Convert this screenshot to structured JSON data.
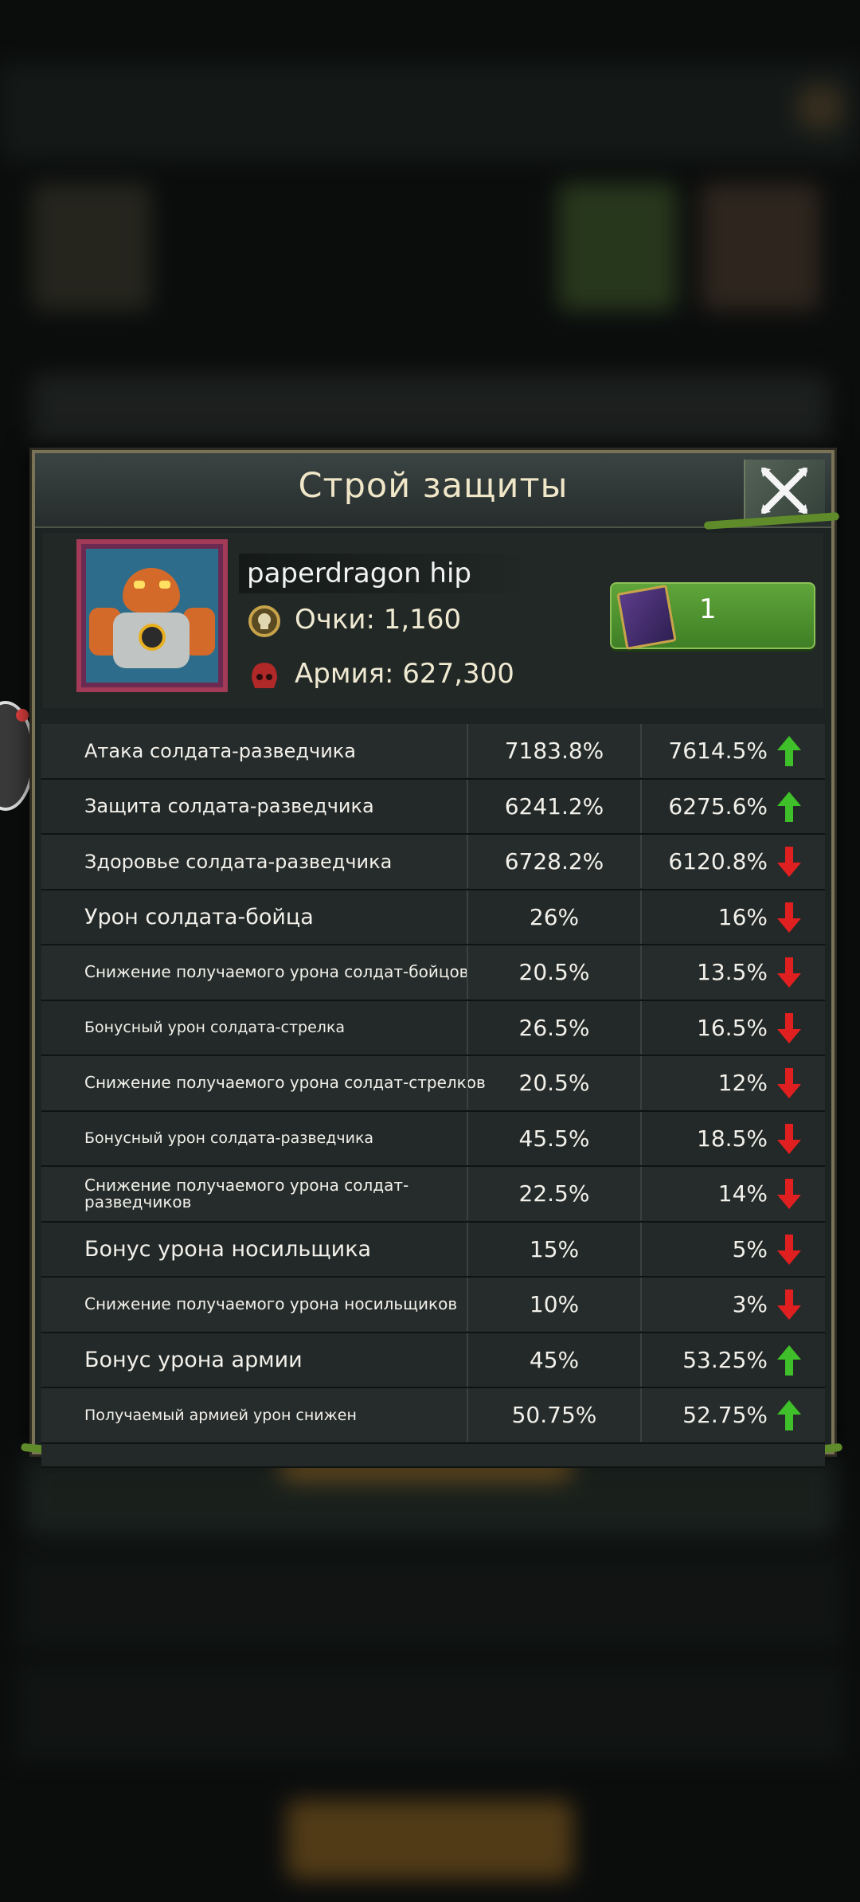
{
  "dialog": {
    "title": "Строй защиты"
  },
  "player": {
    "name": "paperdragon hip",
    "points_label": "Очки: 1,160",
    "army_label": "Армия: 627,300"
  },
  "book_button": {
    "count": "1"
  },
  "stats": [
    {
      "label": "Атака солдата-разведчика",
      "v1": "7183.8%",
      "v2": "7614.5%",
      "trend": "up"
    },
    {
      "label": "Защита солдата-разведчика",
      "v1": "6241.2%",
      "v2": "6275.6%",
      "trend": "up"
    },
    {
      "label": "Здоровье солдата-разведчика",
      "v1": "6728.2%",
      "v2": "6120.8%",
      "trend": "down"
    },
    {
      "label": "Урон солдата-бойца",
      "v1": "26%",
      "v2": "16%",
      "trend": "down"
    },
    {
      "label": "Снижение получаемого урона солдат-бойцов",
      "v1": "20.5%",
      "v2": "13.5%",
      "trend": "down"
    },
    {
      "label": "Бонусный урон солдата-стрелка",
      "v1": "26.5%",
      "v2": "16.5%",
      "trend": "down"
    },
    {
      "label": "Снижение получаемого урона солдат-стрелков",
      "v1": "20.5%",
      "v2": "12%",
      "trend": "down"
    },
    {
      "label": "Бонусный урон солдата-разведчика",
      "v1": "45.5%",
      "v2": "18.5%",
      "trend": "down"
    },
    {
      "label": "Снижение получаемого урона солдат-разведчиков",
      "v1": "22.5%",
      "v2": "14%",
      "trend": "down"
    },
    {
      "label": "Бонус урона носильщика",
      "v1": "15%",
      "v2": "5%",
      "trend": "down"
    },
    {
      "label": "Снижение получаемого урона носильщиков",
      "v1": "10%",
      "v2": "3%",
      "trend": "down"
    },
    {
      "label": "Бонус урона армии",
      "v1": "45%",
      "v2": "53.25%",
      "trend": "up"
    },
    {
      "label": "Получаемый армией урон снижен",
      "v1": "50.75%",
      "v2": "52.75%",
      "trend": "up"
    }
  ],
  "colors": {
    "up": "#3fbf2a",
    "down": "#e02020",
    "button_green": "#4f952f",
    "frame": "#7a7357"
  },
  "icons": {
    "close": "close-icon",
    "points": "skull-medal-icon",
    "army": "army-helmet-icon",
    "book": "book-icon",
    "up": "arrow-up-icon",
    "down": "arrow-down-icon"
  }
}
